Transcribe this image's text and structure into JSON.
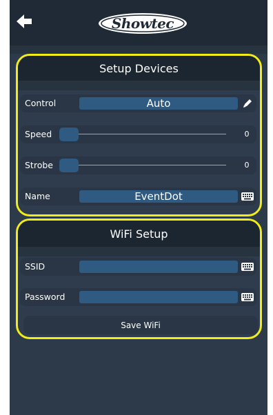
{
  "header": {
    "logo_text": "Showtec",
    "back_icon": "back-arrow-icon"
  },
  "setup": {
    "title": "Setup Devices",
    "control": {
      "label": "Control",
      "value": "Auto",
      "icon": "pencil-icon"
    },
    "speed": {
      "label": "Speed",
      "value": "0",
      "level": 0
    },
    "strobe": {
      "label": "Strobe",
      "value": "0",
      "level": 0
    },
    "name": {
      "label": "Name",
      "value": "EventDot",
      "icon": "keyboard-icon"
    }
  },
  "wifi": {
    "title": "WiFi Setup",
    "ssid": {
      "label": "SSID",
      "value": "",
      "icon": "keyboard-icon"
    },
    "password": {
      "label": "Password",
      "value": "",
      "icon": "keyboard-icon"
    },
    "save_label": "Save WiFi"
  },
  "colors": {
    "accent_outline": "#f1ec1a",
    "background": "#2c3a4a",
    "header": "#1f2a36",
    "field": "#2f5a82"
  }
}
